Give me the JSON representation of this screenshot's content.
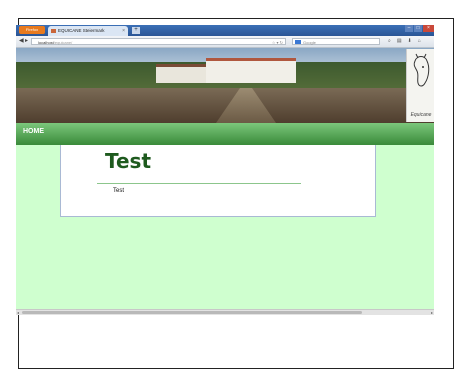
{
  "browser": {
    "app_button": "Firefox",
    "tab_title": "EQUICANE Steiermark",
    "new_tab": "+",
    "url_host": "localhost",
    "url_path": "/equicane/",
    "search_placeholder": "Google"
  },
  "site": {
    "logo_text": "Equicane",
    "nav": [
      {
        "label": "HOME"
      }
    ],
    "page_title": "Test",
    "body_text": "Test"
  },
  "colors": {
    "menu_green": "#4f9f4f",
    "page_bg": "#cfffcf",
    "title_green": "#1e5a1e"
  }
}
